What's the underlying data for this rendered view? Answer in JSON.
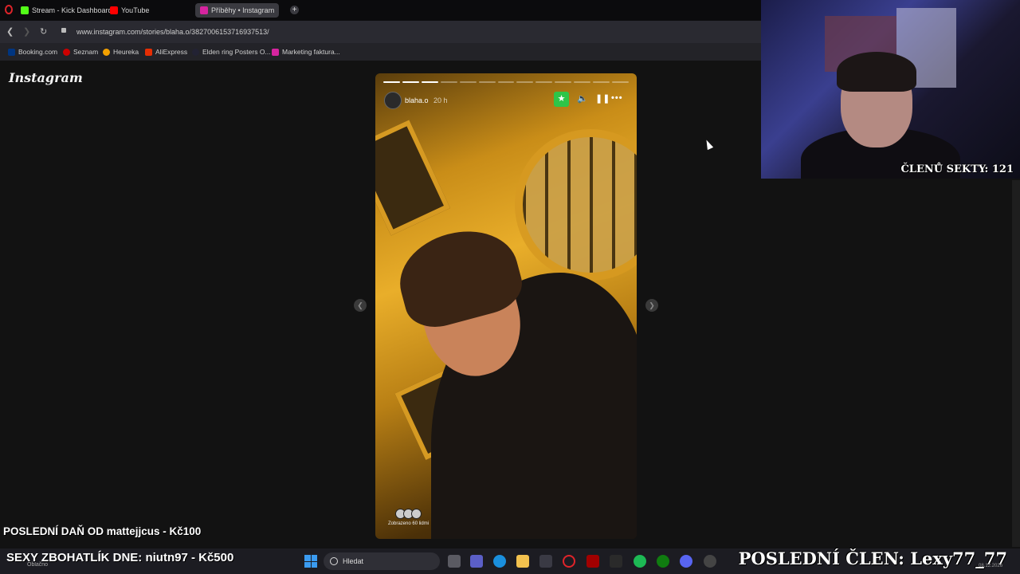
{
  "browser": {
    "tabs": [
      {
        "label": "Stream - Kick Dashboard",
        "color": "#53fc18"
      },
      {
        "label": "YouTube",
        "color": "#ff0000"
      },
      {
        "label": "Příběhy • Instagram",
        "color": "#d6249f",
        "active": true
      }
    ],
    "url": "www.instagram.com/stories/blaha.o/3827006153716937513/",
    "bookmarks": [
      {
        "label": "Booking.com",
        "color": "#003580"
      },
      {
        "label": "Seznam",
        "color": "#cc0000"
      },
      {
        "label": "Heureka",
        "color": "#f4a100"
      },
      {
        "label": "AliExpress",
        "color": "#e62e04"
      },
      {
        "label": "Elden ring Posters O...",
        "color": "#222233"
      },
      {
        "label": "Marketing faktura...",
        "color": "#d6249f"
      }
    ]
  },
  "instagram": {
    "logo": "Instagram",
    "story": {
      "username": "blaha.o",
      "time": "20 h",
      "seen_by": "Zobrazeno 60 lidmi",
      "segments_total": 13,
      "segments_done": 3
    }
  },
  "webcam": {
    "label": "ČLENŮ SEKTY: 121"
  },
  "overlays": {
    "last_tax": "POSLEDNÍ DAŇ OD mattejjcus - Kč100",
    "sexy": "SEXY ZBOHATLÍK DNE: niutn97 - Kč500",
    "last_member": "POSLEDNÍ ČLEN: Lexy77_77"
  },
  "taskbar": {
    "weather": "Oblačno",
    "search_placeholder": "Hledat",
    "clock": "08.12.2026"
  },
  "colors": {
    "accent_green": "#2ec548",
    "windows_blue": "#3a9bf0"
  }
}
